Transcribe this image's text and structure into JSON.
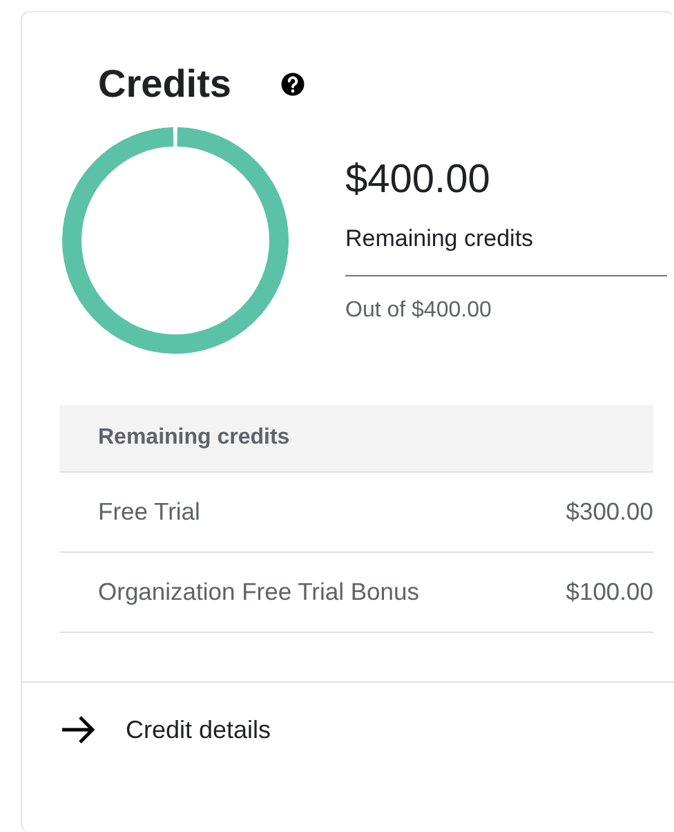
{
  "card": {
    "title": "Credits",
    "summary": {
      "amount": "$400.00",
      "label": "Remaining credits",
      "total": "Out of $400.00",
      "level": 1
    },
    "table": {
      "header": "Remaining credits",
      "rows": [
        {
          "name": "Free Trial",
          "amount": "$300.00"
        },
        {
          "name": "Organization Free Trial Bonus",
          "amount": "$100.00"
        }
      ]
    },
    "footer_link": "Credit details"
  }
}
